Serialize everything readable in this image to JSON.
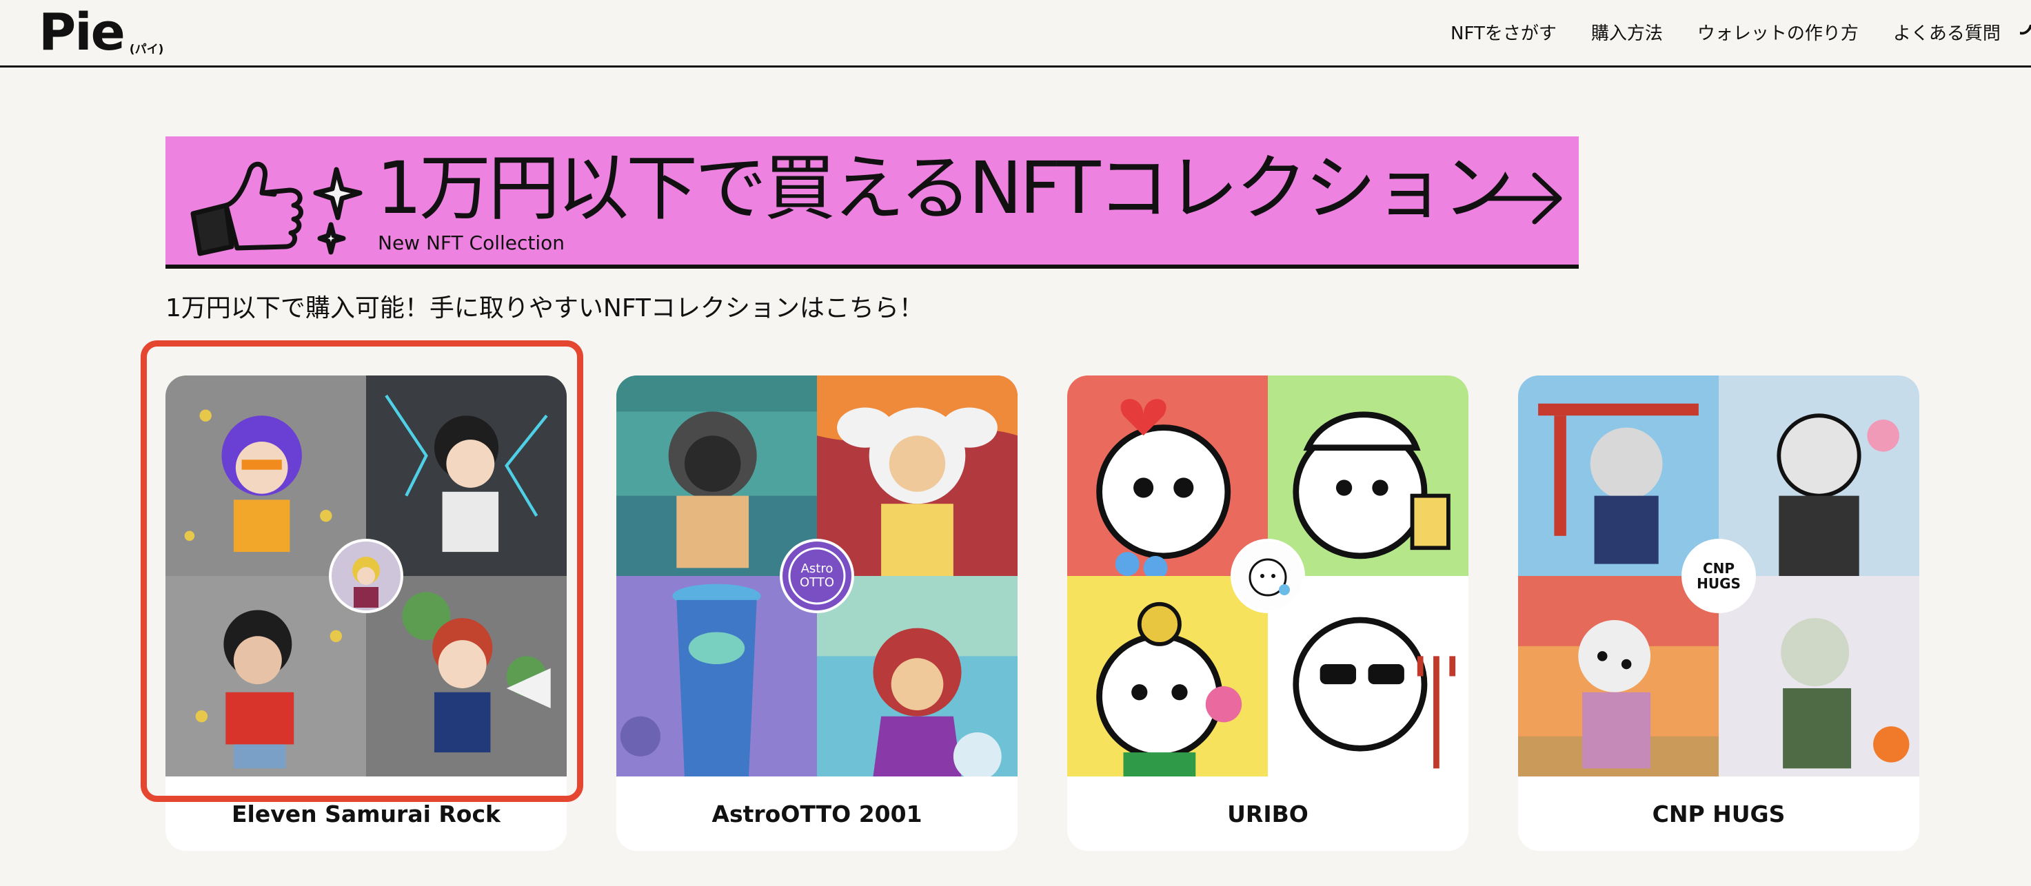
{
  "header": {
    "logo": "Pie",
    "logo_sub": "(パイ)",
    "nav": [
      "NFTをさがす",
      "購入方法",
      "ウォレットの作り方",
      "よくある質問"
    ]
  },
  "banner": {
    "title": "1万円以下で買えるNFTコレクション",
    "subtitle": "New NFT Collection"
  },
  "lead": "1万円以下で購入可能！手に取りやすいNFTコレクションはこちら！",
  "collections": [
    {
      "name": "Eleven Samurai Rock",
      "badge_text": ""
    },
    {
      "name": "AstroOTTO 2001",
      "badge_text": "Astro OTTO"
    },
    {
      "name": "URIBO",
      "badge_text": ""
    },
    {
      "name": "CNP HUGS",
      "badge_text": "CNP HUGS"
    }
  ],
  "colors": {
    "banner": "#ee82e0",
    "highlight": "#e5462f",
    "page_bg": "#f7f5f2"
  }
}
